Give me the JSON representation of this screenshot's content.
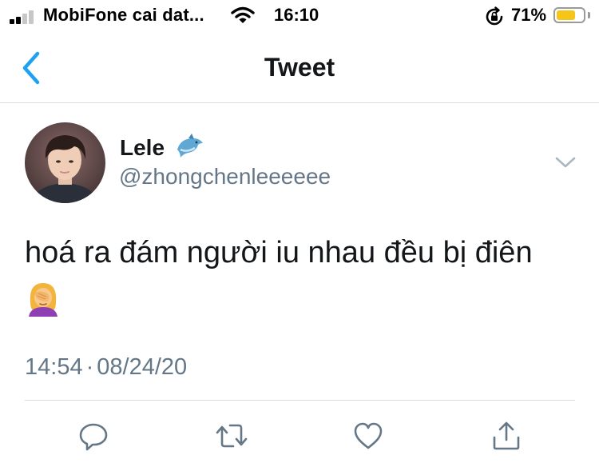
{
  "status_bar": {
    "carrier": "MobiFone cai dat...",
    "time": "16:10",
    "battery_percent": "71%",
    "battery_level": 0.71,
    "signal_bars_active": 2,
    "icons": [
      "signal-icon",
      "wifi-icon",
      "orientation-lock-icon",
      "battery-icon"
    ]
  },
  "nav": {
    "title": "Tweet",
    "back_icon": "chevron-left-icon",
    "accent_color": "#1da1f2"
  },
  "tweet": {
    "display_name": "Lele",
    "name_emoji": "dolphin-icon",
    "handle": "@zhongchenleeeeee",
    "text": "hoá ra đám người iu nhau đều bị điên",
    "text_emoji": "person-facepalming-icon",
    "time": "14:54",
    "separator": "·",
    "date": "08/24/20",
    "more_icon": "chevron-down-icon"
  },
  "actions": [
    {
      "name": "reply",
      "icon": "reply-icon"
    },
    {
      "name": "retweet",
      "icon": "retweet-icon"
    },
    {
      "name": "like",
      "icon": "heart-icon"
    },
    {
      "name": "share",
      "icon": "share-icon"
    }
  ],
  "colors": {
    "text_primary": "#14171a",
    "text_secondary": "#657786",
    "divider": "#d7dde2",
    "battery_fill": "#f5c518"
  }
}
